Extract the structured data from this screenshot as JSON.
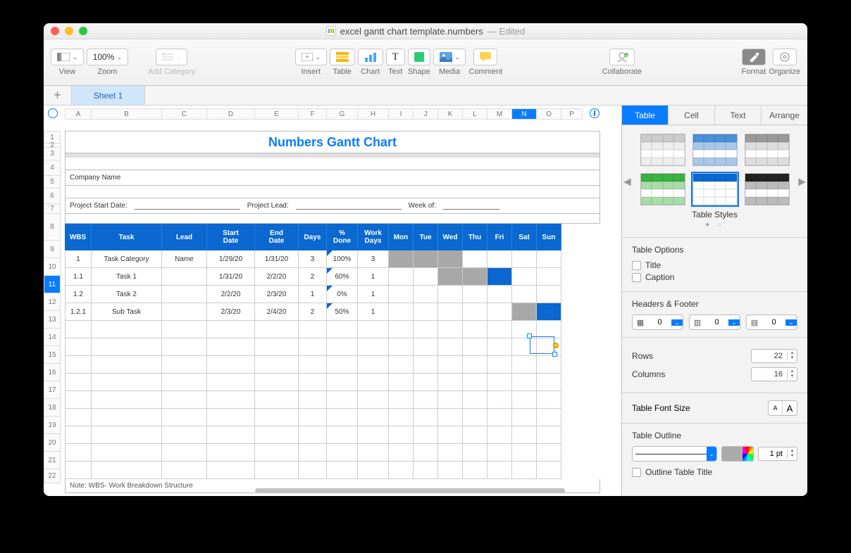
{
  "window": {
    "filename": "excel gantt chart template.numbers",
    "edited": "— Edited"
  },
  "toolbar": {
    "view": "View",
    "zoom": "Zoom",
    "zoom_val": "100%",
    "add_category": "Add Category",
    "insert": "Insert",
    "table": "Table",
    "chart": "Chart",
    "text": "Text",
    "shape": "Shape",
    "media": "Media",
    "comment": "Comment",
    "collaborate": "Collaborate",
    "format": "Format",
    "organize": "Organize"
  },
  "sheet": {
    "name": "Sheet 1"
  },
  "columns": [
    "A",
    "B",
    "C",
    "D",
    "E",
    "F",
    "G",
    "H",
    "I",
    "J",
    "K",
    "L",
    "M",
    "N",
    "O",
    "P"
  ],
  "rows": [
    "1",
    "2",
    "3",
    "4",
    "5",
    "6",
    "7",
    "8",
    "9",
    "10",
    "11",
    "12",
    "13",
    "14",
    "15",
    "16",
    "17",
    "18",
    "19",
    "20",
    "21",
    "22"
  ],
  "table": {
    "title": "Numbers Gantt Chart",
    "company": "Company Name",
    "start_label": "Project Start Date:",
    "lead_label": "Project Lead:",
    "week_label": "Week of:",
    "headers": [
      "WBS",
      "Task",
      "Lead",
      "Start Date",
      "End Date",
      "Days",
      "% Done",
      "Work Days",
      "Mon",
      "Tue",
      "Wed",
      "Thu",
      "Fri",
      "Sat",
      "Sun"
    ],
    "data": [
      {
        "wbs": "1",
        "task": "Task Category",
        "lead": "Name",
        "start": "1/29/20",
        "end": "1/31/20",
        "days": "3",
        "pct": "100%",
        "wdays": "3",
        "bars": [
          1,
          1,
          1,
          0,
          0,
          0,
          0
        ]
      },
      {
        "wbs": "1.1",
        "task": "Task 1",
        "lead": "",
        "start": "1/31/20",
        "end": "2/2/20",
        "days": "2",
        "pct": "60%",
        "wdays": "1",
        "bars": [
          0,
          0,
          1,
          1,
          2,
          0,
          0
        ]
      },
      {
        "wbs": "1.2",
        "task": "Task 2",
        "lead": "",
        "start": "2/2/20",
        "end": "2/3/20",
        "days": "1",
        "pct": "0%",
        "wdays": "1",
        "bars": [
          0,
          0,
          0,
          0,
          0,
          0,
          0
        ]
      },
      {
        "wbs": "1.2.1",
        "task": "Sub Task",
        "lead": "",
        "start": "2/3/20",
        "end": "2/4/20",
        "days": "2",
        "pct": "50%",
        "wdays": "1",
        "bars": [
          0,
          0,
          0,
          0,
          0,
          1,
          2
        ]
      }
    ],
    "footnote": "Note: WBS- Work Breakdown Structure"
  },
  "inspector": {
    "tabs": [
      "Table",
      "Cell",
      "Text",
      "Arrange"
    ],
    "styles_label": "Table Styles",
    "opts_title": "Table Options",
    "opt_title": "Title",
    "opt_caption": "Caption",
    "hf_title": "Headers & Footer",
    "hf_vals": [
      "0",
      "0",
      "0"
    ],
    "rows_label": "Rows",
    "rows_val": "22",
    "cols_label": "Columns",
    "cols_val": "16",
    "fs_label": "Table Font Size",
    "outline_title": "Table Outline",
    "outline_pt": "1 pt",
    "outline_chk": "Outline Table Title"
  }
}
